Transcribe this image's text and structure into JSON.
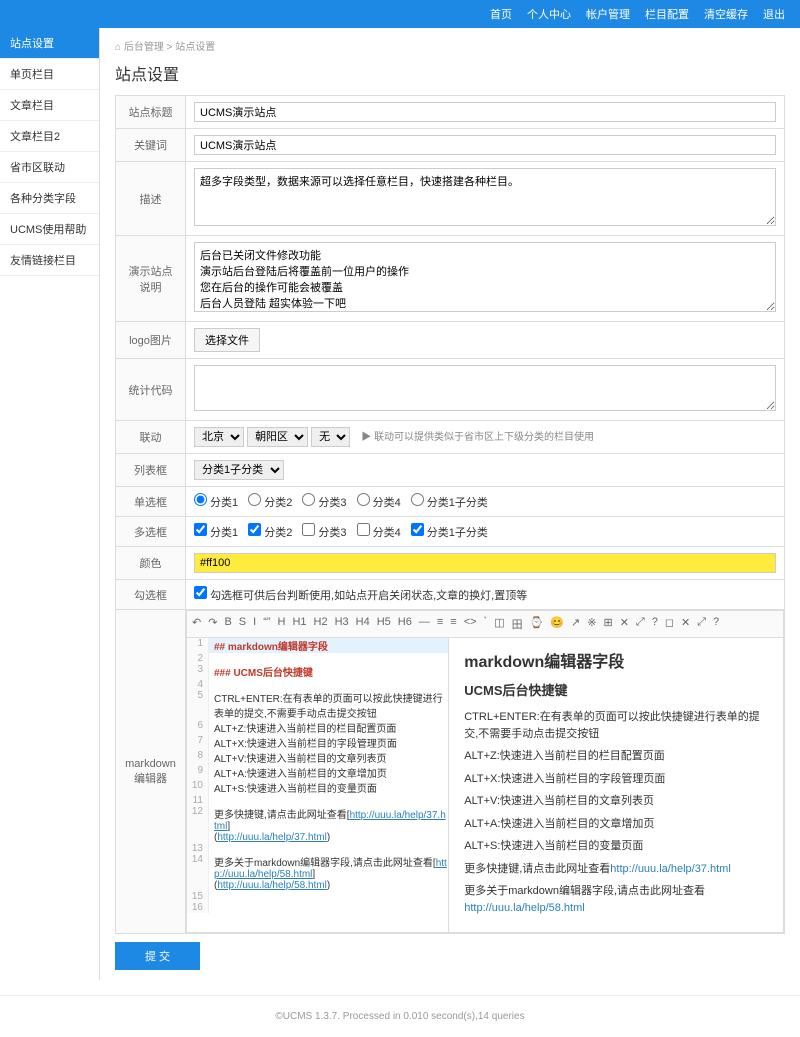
{
  "topnav": [
    "首页",
    "个人中心",
    "帐户管理",
    "栏目配置",
    "清空缓存",
    "退出"
  ],
  "sidebar": {
    "items": [
      "站点设置",
      "单页栏目",
      "文章栏目",
      "文章栏目2",
      "省市区联动",
      "各种分类字段",
      "UCMS使用帮助",
      "友情链接栏目"
    ],
    "activeIndex": 0
  },
  "crumb": {
    "home": "后台管理",
    "sep": ">",
    "current": "站点设置"
  },
  "pageTitle": "站点设置",
  "labels": {
    "siteTitle": "站点标题",
    "keywords": "关键词",
    "desc": "描述",
    "demo": "演示站点说明",
    "logo": "logo图片",
    "stats": "统计代码",
    "linkage": "联动",
    "listbox": "列表框",
    "radio": "单选框",
    "checkbox": "多选框",
    "color": "颜色",
    "checkopt": "勾选框",
    "markdown": "markdown编辑器"
  },
  "values": {
    "siteTitle": "UCMS演示站点",
    "keywords": "UCMS演示站点",
    "desc": "超多字段类型，数据来源可以选择任意栏目，快速搭建各种栏目。",
    "demo": "后台已关闭文件修改功能\n演示站后台登陆后将覆盖前一位用户的操作\n您在后台的操作可能会被覆盖\n后台人员登陆 超实体验一下吧",
    "fileBtn": "选择文件",
    "stats": "",
    "linkage": {
      "prov": "北京",
      "city": "朝阳区",
      "dist": "无",
      "note": "▶ 联动可以提供类似于省市区上下级分类的栏目使用"
    },
    "listbox": "分类1子分类",
    "radios": [
      "分类1",
      "分类2",
      "分类3",
      "分类4",
      "分类1子分类"
    ],
    "radioChecked": 0,
    "checks": [
      "分类1",
      "分类2",
      "分类3",
      "分类4",
      "分类1子分类"
    ],
    "checksOn": [
      true,
      true,
      false,
      false,
      true
    ],
    "color": "#ff100",
    "checkoptText": "勾选框可供后台判断使用,如站点开启关闭状态,文章的换灯,置顶等",
    "submit": "提 交"
  },
  "editor": {
    "toolbarIcons": [
      "↶",
      "↷",
      "B",
      "S",
      "I",
      "“”",
      "H",
      "H1",
      "H2",
      "H3",
      "H4",
      "H5",
      "H6",
      "—",
      "≡",
      "≡",
      "<>",
      "`",
      "◫",
      "田",
      "⌚",
      "😊",
      "↗",
      "※",
      "⊞",
      "✕",
      "⤢",
      "?",
      "◻",
      "✕",
      "⤢",
      "?"
    ],
    "lines": [
      {
        "n": 1,
        "raw": "## markdown编辑器字段",
        "cls": "hl kw"
      },
      {
        "n": 2,
        "raw": ""
      },
      {
        "n": 3,
        "raw": "### UCMS后台快捷键",
        "cls": "kw"
      },
      {
        "n": 4,
        "raw": ""
      },
      {
        "n": 5,
        "raw": "CTRL+ENTER:在有表单的页面可以按此快捷键进行表单的提交,不需要手动点击提交按钮"
      },
      {
        "n": 6,
        "raw": "ALT+Z:快速进入当前栏目的栏目配置页面"
      },
      {
        "n": 7,
        "raw": "ALT+X:快速进入当前栏目的字段管理页面"
      },
      {
        "n": 8,
        "raw": "ALT+V:快速进入当前栏目的文章列表页"
      },
      {
        "n": 9,
        "raw": "ALT+A:快速进入当前栏目的文章增加页"
      },
      {
        "n": 10,
        "raw": "ALT+S:快速进入当前栏目的变量页面"
      },
      {
        "n": 11,
        "raw": ""
      },
      {
        "n": 12,
        "raw": "更多快捷键,请点击此网址查看[http://uuu.la/help/37.html](http://uuu.la/help/37.html)"
      },
      {
        "n": 13,
        "raw": ""
      },
      {
        "n": 14,
        "raw": "更多关于markdown编辑器字段,请点击此网址查看[http://uuu.la/help/58.html](http://uuu.la/help/58.html)"
      },
      {
        "n": 15,
        "raw": ""
      },
      {
        "n": 16,
        "raw": ""
      }
    ],
    "preview": {
      "h2": "markdown编辑器字段",
      "h3": "UCMS后台快捷键",
      "p": [
        "CTRL+ENTER:在有表单的页面可以按此快捷键进行表单的提交,不需要手动点击提交按钮",
        "ALT+Z:快速进入当前栏目的栏目配置页面",
        "ALT+X:快速进入当前栏目的字段管理页面",
        "ALT+V:快速进入当前栏目的文章列表页",
        "ALT+A:快速进入当前栏目的文章增加页",
        "ALT+S:快速进入当前栏目的变量页面"
      ],
      "more1": {
        "t": "更多快捷键,请点击此网址查看",
        "a": "http://uuu.la/help/37.html"
      },
      "more2": {
        "t": "更多关于markdown编辑器字段,请点击此网址查看",
        "a": "http://uuu.la/help/58.html"
      }
    }
  },
  "footer": "©UCMS 1.3.7. Processed in 0.010 second(s),14 queries"
}
